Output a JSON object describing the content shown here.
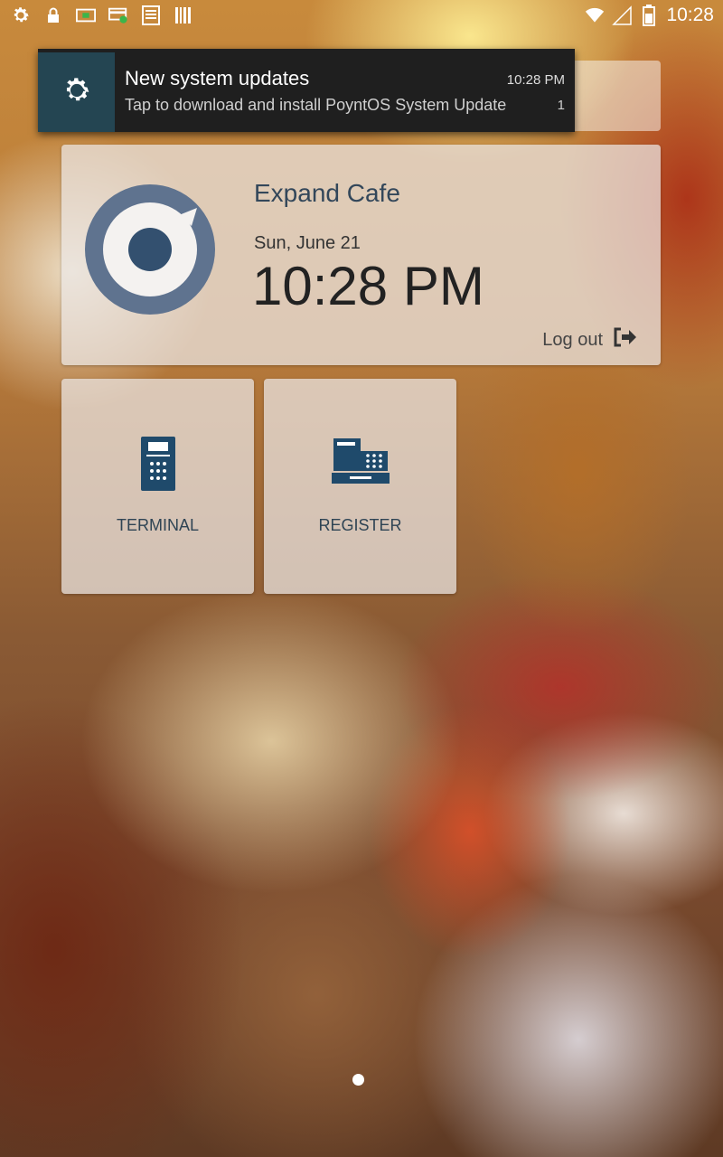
{
  "status_bar": {
    "time": "10:28",
    "icons": [
      "settings-icon",
      "lock-icon",
      "payment-terminal-icon",
      "card-check-icon",
      "receipt-icon",
      "barcode-icon",
      "wifi-icon",
      "signal-icon",
      "battery-icon"
    ]
  },
  "notification": {
    "title": "New system updates",
    "time": "10:28 PM",
    "text": "Tap to download and install PoyntOS System Update",
    "count": "1",
    "icon": "system-update-icon",
    "accent": "#244552"
  },
  "main_card": {
    "merchant_name": "Expand Cafe",
    "date": "Sun, June 21",
    "time": "10:28 PM",
    "logout_label": "Log out",
    "logo_colors": {
      "ring": "#5f738f",
      "center": "#33506f"
    }
  },
  "tiles": [
    {
      "label": "TERMINAL",
      "icon": "terminal-icon"
    },
    {
      "label": "REGISTER",
      "icon": "cash-register-icon"
    }
  ],
  "pager": {
    "pages": 1,
    "current": 1
  },
  "colors": {
    "icon_blue": "#1f4a6b",
    "text_dark": "#33475a"
  }
}
